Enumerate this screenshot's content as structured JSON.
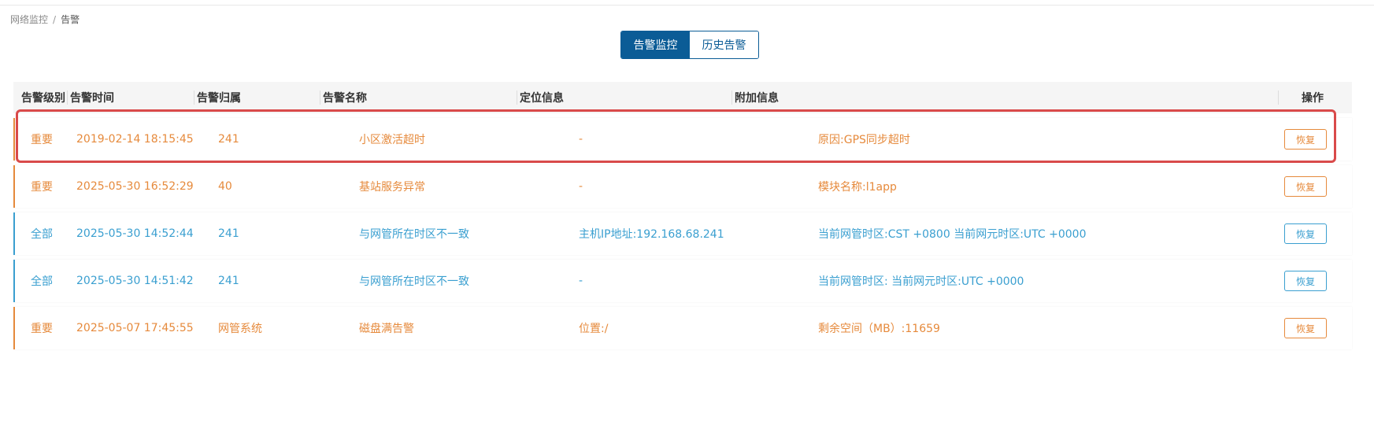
{
  "breadcrumb": {
    "parent": "网络监控",
    "separator": "/",
    "current": "告警"
  },
  "tabs": [
    {
      "label": "告警监控",
      "active": true
    },
    {
      "label": "历史告警",
      "active": false
    }
  ],
  "table": {
    "headers": [
      "告警级别",
      "告警时间",
      "告警归属",
      "告警名称",
      "定位信息",
      "附加信息",
      "操作"
    ],
    "rows": [
      {
        "level": "重要",
        "time": "2019-02-14 18:15:45",
        "owner": "241",
        "name": "小区激活超时",
        "location": "-",
        "extra": "原因:GPS同步超时",
        "action": "恢复",
        "tone": "orange"
      },
      {
        "level": "重要",
        "time": "2025-05-30 16:52:29",
        "owner": "40",
        "name": "基站服务异常",
        "location": "-",
        "extra": "模块名称:l1app",
        "action": "恢复",
        "tone": "orange"
      },
      {
        "level": "全部",
        "time": "2025-05-30 14:52:44",
        "owner": "241",
        "name": "与网管所在时区不一致",
        "location": "主机IP地址:192.168.68.241",
        "extra": "当前网管时区:CST +0800 当前网元时区:UTC +0000",
        "action": "恢复",
        "tone": "blue"
      },
      {
        "level": "全部",
        "time": "2025-05-30 14:51:42",
        "owner": "241",
        "name": "与网管所在时区不一致",
        "location": "-",
        "extra": "当前网管时区: 当前网元时区:UTC +0000",
        "action": "恢复",
        "tone": "blue"
      },
      {
        "level": "重要",
        "time": "2025-05-07 17:45:55",
        "owner": "网管系统",
        "name": "磁盘满告警",
        "location": "位置:/",
        "extra": "剩余空间（MB）:11659",
        "action": "恢复",
        "tone": "orange"
      }
    ]
  },
  "colors": {
    "primary": "#0b5c96",
    "important": "#e68a3c",
    "all": "#3a9fd0",
    "highlight": "#d94a4a"
  }
}
